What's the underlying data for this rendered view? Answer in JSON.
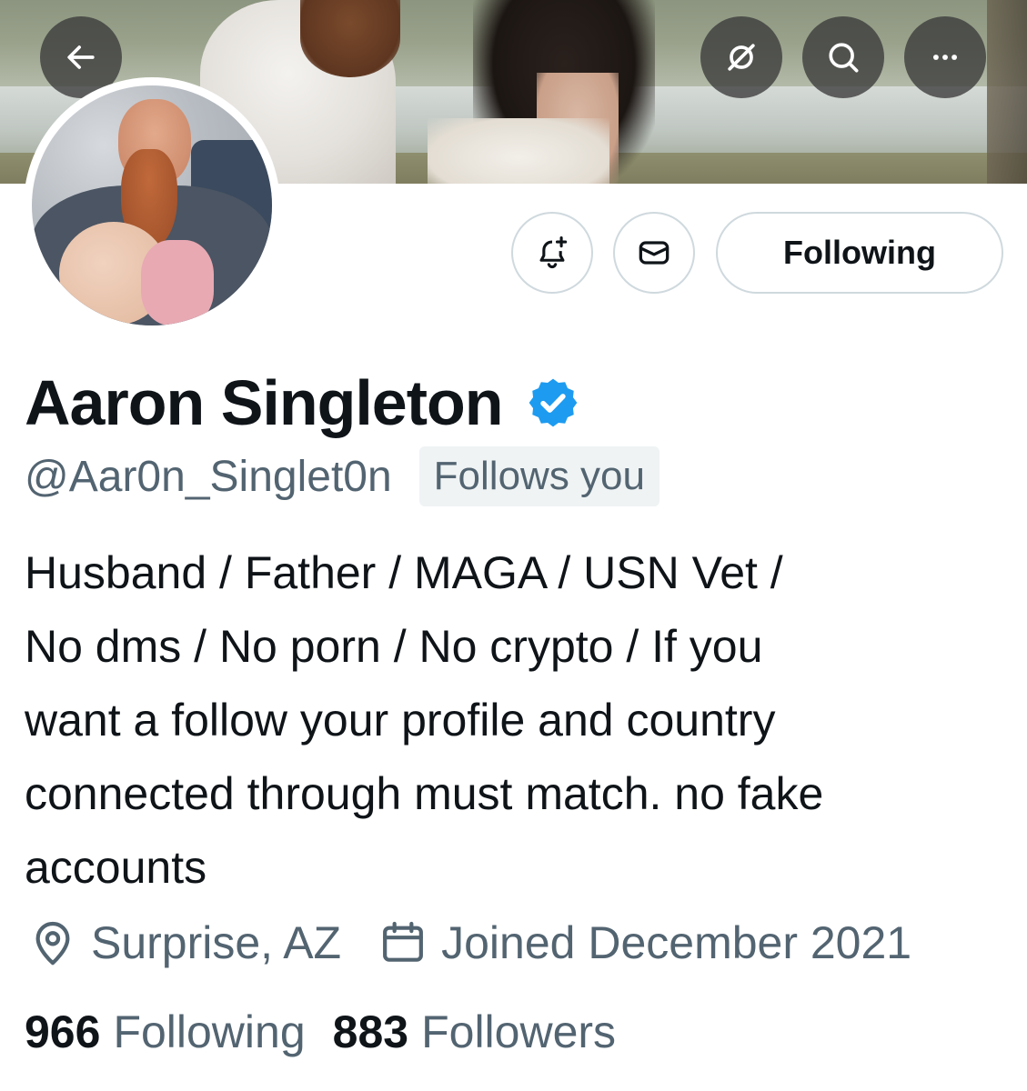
{
  "header": {
    "back_icon": "arrow-left-icon",
    "grok_icon": "grok-slash-circle-icon",
    "search_icon": "search-icon",
    "more_icon": "more-horizontal-icon"
  },
  "profile": {
    "display_name": "Aaron Singleton",
    "verified_icon": "verified-badge-icon",
    "verified_color": "#1d9bf0",
    "handle": "@Aar0n_Singlet0n",
    "follows_you": "Follows you",
    "bio_lines": [
      "Husband / Father / MAGA / USN Vet /",
      "No dms / No porn / No crypto / If you",
      "want a follow your profile and country",
      "connected through must match. no fake",
      "accounts"
    ],
    "location": "Surprise, AZ",
    "joined": "Joined December 2021",
    "following_count": "966",
    "following_label": "Following",
    "followers_count": "883",
    "followers_label": "Followers"
  },
  "actions": {
    "notify_icon": "bell-plus-icon",
    "message_icon": "envelope-icon",
    "following_button": "Following"
  }
}
